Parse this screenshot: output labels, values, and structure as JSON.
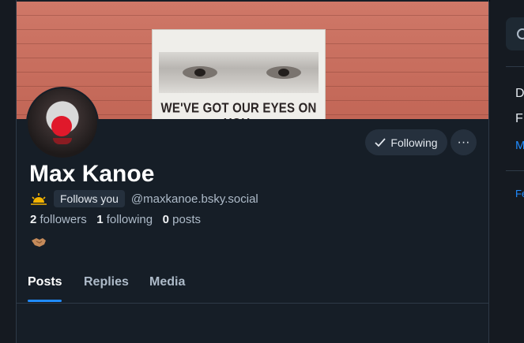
{
  "profile": {
    "display_name": "Max Kanoe",
    "follows_you_label": "Follows you",
    "handle": "@maxkanoe.bsky.social",
    "followers_count": "2",
    "followers_label": "followers",
    "following_count": "1",
    "following_label": "following",
    "posts_count": "0",
    "posts_label": "posts"
  },
  "banner": {
    "sign_text": "WE'VE GOT OUR EYES ON YOU."
  },
  "actions": {
    "following_label": "Following",
    "more_label": "···"
  },
  "tabs": [
    {
      "label": "Posts"
    },
    {
      "label": "Replies"
    },
    {
      "label": "Media"
    }
  ],
  "right_column": {
    "items": [
      "D",
      "F"
    ],
    "link": "M",
    "footer_link": "Fe"
  },
  "colors": {
    "accent": "#208bfe",
    "background": "#161e27"
  }
}
